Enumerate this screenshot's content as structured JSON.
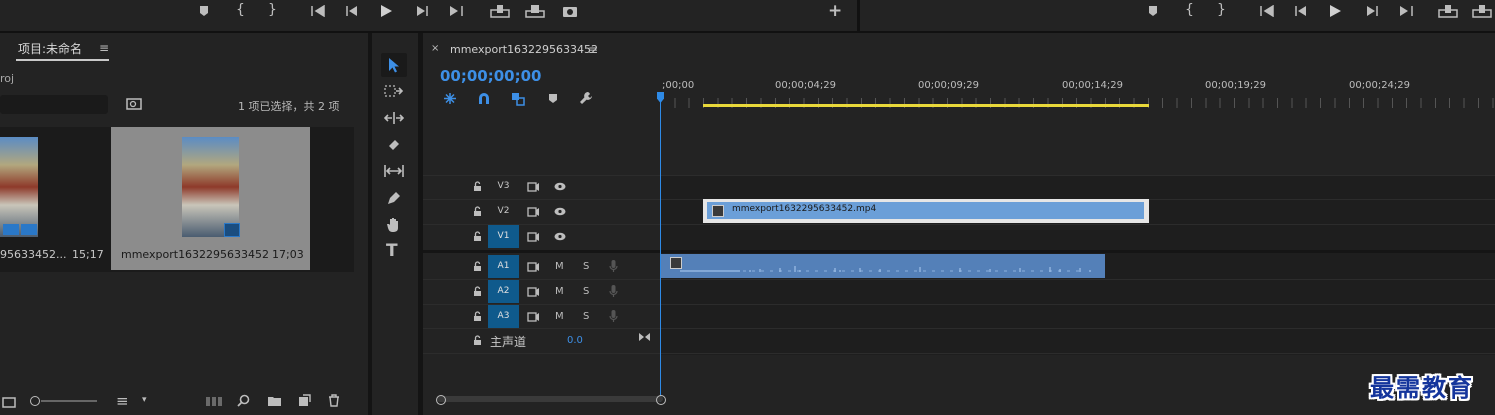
{
  "transport_left": {
    "icons": [
      "marker-icon",
      "mark-in-icon",
      "mark-out-icon",
      "go-to-in-icon",
      "step-back-icon",
      "play-icon",
      "step-forward-icon",
      "go-to-out-icon",
      "insert-icon",
      "overwrite-icon",
      "export-frame-icon",
      "add-button-icon"
    ]
  },
  "transport_right": {
    "icons": [
      "marker-icon",
      "mark-in-icon",
      "mark-out-icon",
      "go-to-in-icon",
      "step-back-icon",
      "play-icon",
      "step-forward-icon",
      "go-to-out-icon",
      "lift-icon",
      "extract-icon"
    ]
  },
  "project": {
    "tab_title": "项目:未命名",
    "path_label": "roj",
    "selection_info": "1 项已选择，共 2 项",
    "items": [
      {
        "name": "95633452...",
        "duration": "15;17"
      },
      {
        "name": "mmexport1632295633452",
        "duration": "17;03"
      }
    ]
  },
  "timeline": {
    "tab_title": "mmexport1632295633452",
    "timecode": "00;00;00;00",
    "ruler_labels": [
      ";00;00",
      "00;00;04;29",
      "00;00;09;29",
      "00;00;14;29",
      "00;00;19;29",
      "00;00;24;29"
    ],
    "video_tracks": [
      "V3",
      "V2",
      "V1"
    ],
    "audio_tracks": [
      "A1",
      "A2",
      "A3"
    ],
    "mute_label": "M",
    "solo_label": "S",
    "master_label": "主声道",
    "master_value": "0.0",
    "clip_name": "mmexport1632295633452.mp4"
  },
  "watermark": "最需教育",
  "colors": {
    "accent_blue": "#3d8fe6",
    "track_target": "#0f5a8c",
    "video_clip": "#6b9fd8",
    "audio_clip": "#5480b8",
    "work_area": "#e8d83a"
  }
}
